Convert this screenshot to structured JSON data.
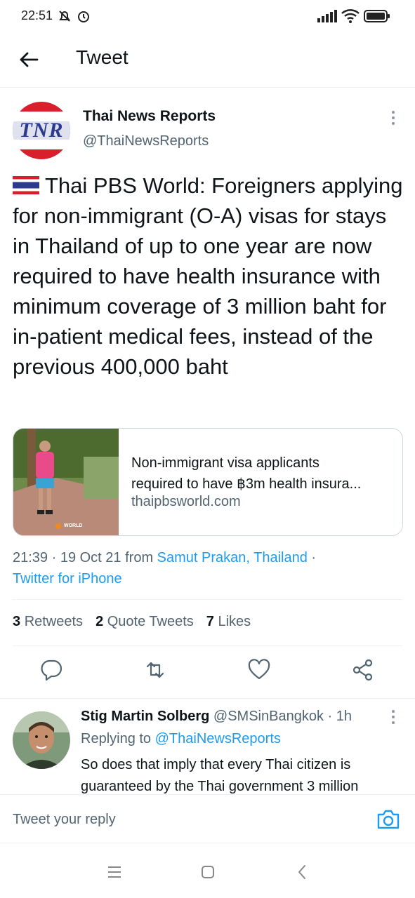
{
  "status_bar": {
    "time": "22:51",
    "icons": [
      "mute-icon",
      "alarm-icon",
      "signal-icon",
      "wifi-icon",
      "battery-icon"
    ]
  },
  "header": {
    "title": "Tweet"
  },
  "tweet": {
    "display_name": "Thai News Reports",
    "handle": "@ThaiNewsReports",
    "avatar_text": "TNR",
    "flag": "🇹🇭",
    "text": "Thai PBS World: Foreigners applying for non-immigrant (O-A) visas for stays in Thailand of up to one year are now required to have health insurance with minimum coverage of 3 million baht for in-patient medical fees, instead of the previous 400,000 baht",
    "card": {
      "title_line1": "Non-immigrant visa applicants",
      "title_line2": "required to have ฿3m health insura...",
      "domain": "thaipbsworld.com",
      "image_badge": "WORLD"
    },
    "meta": {
      "time_date": "21:39 · 19 Oct 21 from ",
      "location": "Samut Prakan, Thailand",
      "sep": " ·",
      "source": "Twitter for iPhone"
    },
    "stats": {
      "retweets_count": "3",
      "retweets_label": "Retweets",
      "quotes_count": "2",
      "quotes_label": "Quote Tweets",
      "likes_count": "7",
      "likes_label": "Likes"
    }
  },
  "reply": {
    "display_name": "Stig Martin Solberg",
    "handle_time": " @SMSinBangkok · 1h",
    "replying_prefix": "Replying to ",
    "replying_to": "@ThaiNewsReports",
    "text": "So does that imply that every Thai citizen is guaranteed by the Thai government 3 million"
  },
  "compose": {
    "placeholder": "Tweet your reply"
  },
  "colors": {
    "accent": "#1d9bf0",
    "secondary": "#536471",
    "primary": "#0f1419"
  }
}
